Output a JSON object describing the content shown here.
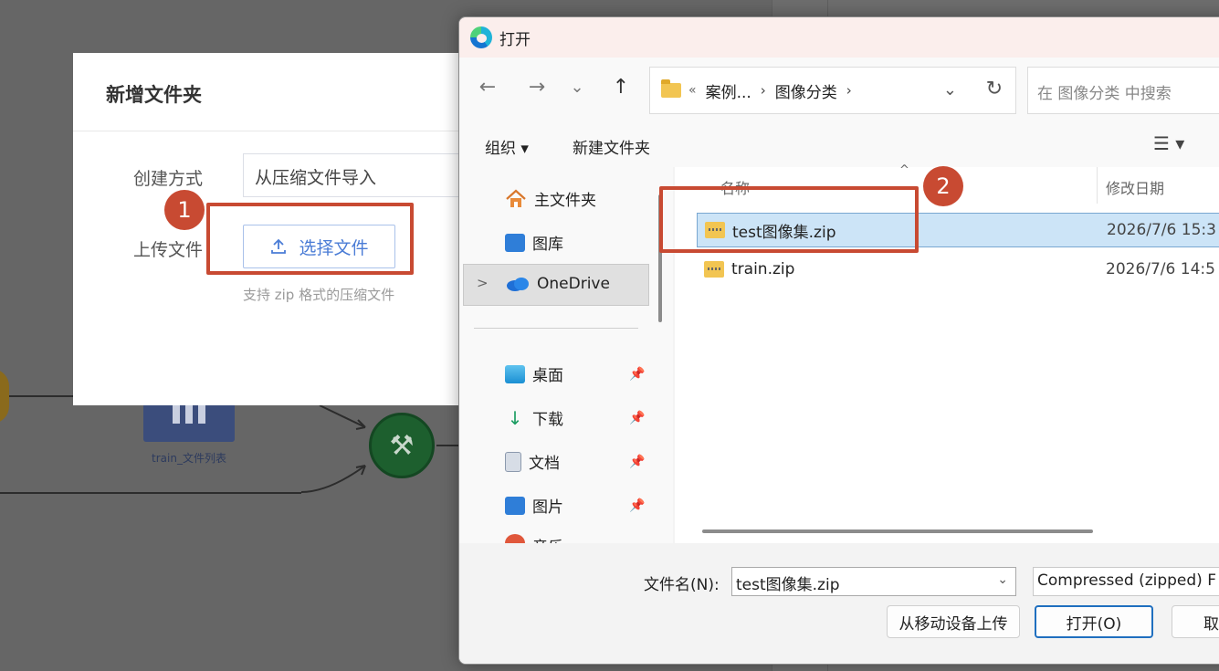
{
  "web_modal": {
    "title": "新增文件夹",
    "method_label": "创建方式",
    "method_value": "从压缩文件导入",
    "upload_label": "上传文件",
    "choose_button": "选择文件",
    "hint": "支持 zip 格式的压缩文件"
  },
  "canvas": {
    "node_label": "train_文件列表"
  },
  "annotations": {
    "badge1": "1",
    "badge2": "2",
    "color": "#c84a32"
  },
  "dialog": {
    "title": "打开",
    "nav": {
      "back_icon": "←",
      "forward_icon": "→",
      "recent_icon": "⌄",
      "up_icon": "↑"
    },
    "address": {
      "overflow": "«",
      "crumb1": "案例...",
      "sep": "›",
      "crumb2": "图像分类",
      "dropdown": "⌄",
      "refresh": "↻"
    },
    "search_placeholder": "在 图像分类 中搜索",
    "commands": {
      "organize": "组织 ▾",
      "new_folder": "新建文件夹",
      "view_icon": "☰ ▾"
    },
    "sidebar": {
      "home": "主文件夹",
      "gallery": "图库",
      "onedrive": "OneDrive",
      "desktop": "桌面",
      "downloads": "下载",
      "documents": "文档",
      "pictures": "图片",
      "music": "音乐",
      "pin_icon": "📌"
    },
    "columns": {
      "name": "名称",
      "modified": "修改日期",
      "sort_icon": "^"
    },
    "files": [
      {
        "name": "test图像集.zip",
        "date": "2026/7/6 15:3"
      },
      {
        "name": "train.zip",
        "date": "2026/7/6 14:5"
      }
    ],
    "bottom": {
      "filename_label": "文件名(N):",
      "filename_value": "test图像集.zip",
      "filetype": "Compressed (zipped) F",
      "upload_mobile": "从移动设备上传",
      "open": "打开(O)",
      "cancel": "取"
    }
  }
}
